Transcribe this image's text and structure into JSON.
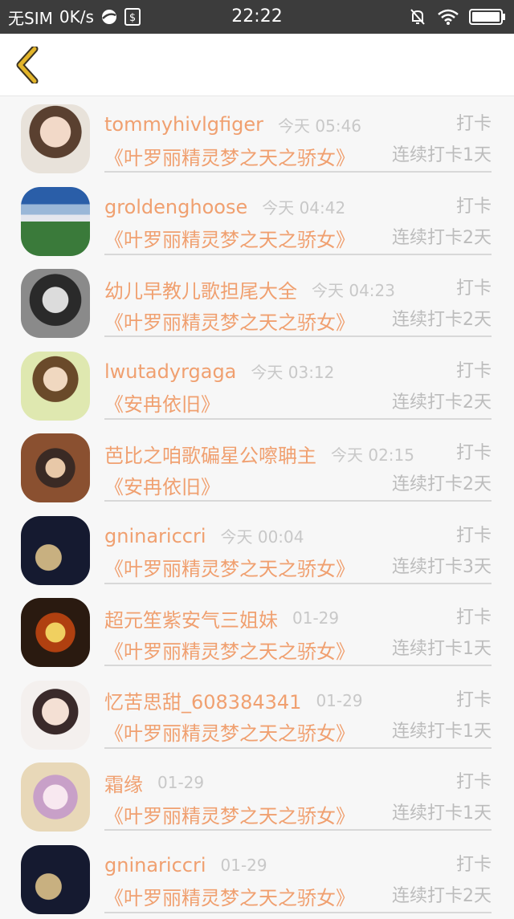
{
  "status_bar": {
    "carrier": "无SIM",
    "speed": "0K/s",
    "time": "22:22"
  },
  "header": {
    "back_icon": "chevron-left-icon",
    "accent_color": "#d4a20a"
  },
  "rows": [
    {
      "name": "tommyhivlgfiger",
      "time": "今天 05:46",
      "action": "打卡",
      "book": "《叶罗丽精灵梦之天之骄女》",
      "streak": "连续打卡1天"
    },
    {
      "name": "groldenghoose",
      "time": "今天 04:42",
      "action": "打卡",
      "book": "《叶罗丽精灵梦之天之骄女》",
      "streak": "连续打卡2天"
    },
    {
      "name": "幼儿早教儿歌担尾大全",
      "time": "今天 04:23",
      "action": "打卡",
      "book": "《叶罗丽精灵梦之天之骄女》",
      "streak": "连续打卡2天"
    },
    {
      "name": "lwutadyrgaga",
      "time": "今天 03:12",
      "action": "打卡",
      "book": "《安冉依旧》",
      "streak": "连续打卡2天"
    },
    {
      "name": "芭比之咱歌碥星公嚓聃主",
      "time": "今天 02:15",
      "action": "打卡",
      "book": "《安冉依旧》",
      "streak": "连续打卡2天"
    },
    {
      "name": "gninariccri",
      "time": "今天 00:04",
      "action": "打卡",
      "book": "《叶罗丽精灵梦之天之骄女》",
      "streak": "连续打卡3天"
    },
    {
      "name": "超元笙紫安气三姐妹",
      "time": "01-29",
      "action": "打卡",
      "book": "《叶罗丽精灵梦之天之骄女》",
      "streak": "连续打卡1天"
    },
    {
      "name": "忆苦思甜_608384341",
      "time": "01-29",
      "action": "打卡",
      "book": "《叶罗丽精灵梦之天之骄女》",
      "streak": "连续打卡1天"
    },
    {
      "name": "霜缘",
      "time": "01-29",
      "action": "打卡",
      "book": "《叶罗丽精灵梦之天之骄女》",
      "streak": "连续打卡1天"
    },
    {
      "name": "gninariccri",
      "time": "01-29",
      "action": "打卡",
      "book": "《叶罗丽精灵梦之天之骄女》",
      "streak": "连续打卡2天"
    }
  ]
}
